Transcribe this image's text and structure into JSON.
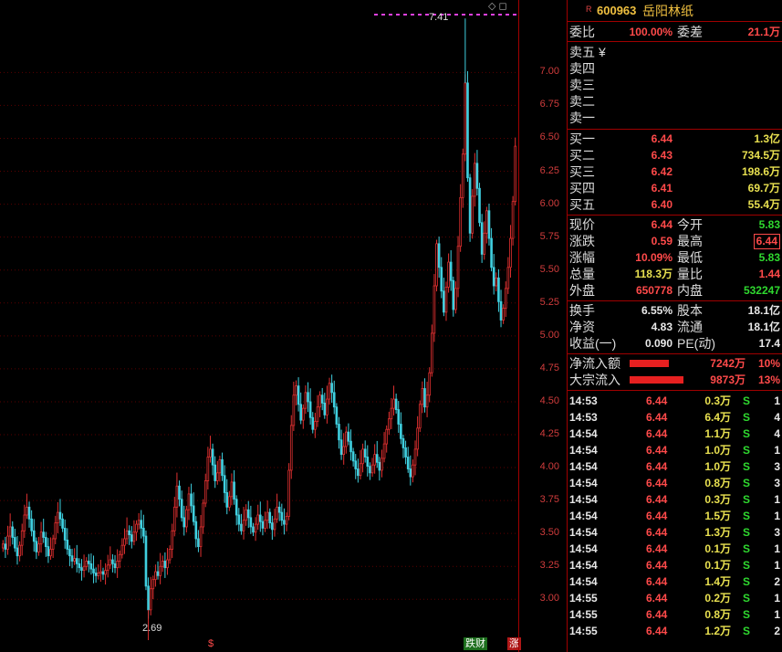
{
  "stock": {
    "r_mark": "R",
    "code": "600963",
    "name": "岳阳林纸"
  },
  "price_axis": {
    "ticks": [
      "7.00",
      "6.75",
      "6.50",
      "6.25",
      "6.00",
      "5.75",
      "5.50",
      "5.25",
      "5.00",
      "4.75",
      "4.50",
      "4.25",
      "4.00",
      "3.75",
      "3.50",
      "3.25",
      "3.00"
    ],
    "high_label": "7.41",
    "low_label": "2.69",
    "top_icons": "◇ ◻"
  },
  "chart_data": {
    "type": "candlestick",
    "y_range": [
      2.6,
      7.55
    ],
    "high": 7.41,
    "low": 2.69,
    "colors": {
      "up": "#e03030",
      "down": "#40d0e0"
    },
    "closes": [
      3.42,
      3.38,
      3.48,
      3.55,
      3.47,
      3.39,
      3.33,
      3.41,
      3.52,
      3.64,
      3.7,
      3.61,
      3.52,
      3.44,
      3.36,
      3.42,
      3.51,
      3.47,
      3.4,
      3.33,
      3.38,
      3.46,
      3.58,
      3.66,
      3.61,
      3.54,
      3.45,
      3.38,
      3.33,
      3.29,
      3.31,
      3.27,
      3.24,
      3.22,
      3.25,
      3.29,
      3.27,
      3.23,
      3.2,
      3.18,
      3.2,
      3.21,
      3.19,
      3.22,
      3.26,
      3.3,
      3.27,
      3.24,
      3.29,
      3.34,
      3.41,
      3.46,
      3.52,
      3.49,
      3.44,
      3.51,
      3.57,
      3.6,
      3.54,
      3.48,
      3.1,
      2.92,
      3.08,
      3.15,
      3.21,
      3.18,
      3.25,
      3.29,
      3.24,
      3.3,
      3.38,
      3.52,
      3.7,
      3.86,
      3.76,
      3.62,
      3.55,
      3.68,
      3.8,
      3.71,
      3.59,
      3.46,
      3.4,
      3.55,
      3.73,
      3.9,
      4.08,
      4.14,
      4.02,
      3.9,
      3.96,
      4.06,
      3.94,
      3.81,
      3.7,
      3.78,
      3.89,
      3.76,
      3.64,
      3.57,
      3.52,
      3.6,
      3.68,
      3.62,
      3.55,
      3.51,
      3.57,
      3.64,
      3.59,
      3.54,
      3.6,
      3.66,
      3.58,
      3.53,
      3.61,
      3.7,
      3.66,
      3.6,
      3.57,
      3.63,
      3.98,
      4.32,
      4.55,
      4.62,
      4.48,
      4.36,
      4.45,
      4.57,
      4.5,
      4.38,
      4.29,
      4.35,
      4.46,
      4.55,
      4.49,
      4.4,
      4.52,
      4.64,
      4.57,
      4.46,
      4.33,
      4.21,
      4.1,
      4.16,
      4.27,
      4.2,
      4.12,
      4.05,
      3.99,
      3.94,
      4.03,
      4.14,
      4.08,
      4.01,
      3.96,
      4.02,
      4.1,
      4.04,
      3.98,
      4.07,
      4.18,
      4.29,
      4.37,
      4.45,
      4.52,
      4.44,
      4.33,
      4.22,
      4.15,
      4.08,
      3.99,
      3.93,
      4.02,
      4.14,
      4.3,
      4.48,
      4.6,
      4.46,
      4.55,
      4.72,
      5.02,
      5.38,
      5.7,
      5.52,
      5.34,
      5.18,
      5.37,
      5.56,
      5.42,
      5.2,
      5.36,
      5.68,
      6.05,
      6.38,
      6.92,
      6.2,
      5.78,
      6.06,
      6.31,
      6.12,
      5.86,
      5.62,
      5.78,
      5.95,
      5.74,
      5.52,
      5.38,
      5.44,
      5.26,
      5.12,
      5.21,
      5.36,
      5.52,
      5.74,
      6.02,
      6.44
    ],
    "volume_axis_markers": [
      "$",
      "跌财",
      "涨"
    ]
  },
  "order_book": {
    "weibi_label": "委比",
    "weibi_value": "100.00%",
    "weicha_label": "委差",
    "weicha_value": "21.1万",
    "sell": [
      {
        "label": "卖五",
        "suffix": "¥"
      },
      {
        "label": "卖四"
      },
      {
        "label": "卖三"
      },
      {
        "label": "卖二"
      },
      {
        "label": "卖一"
      }
    ],
    "buy": [
      {
        "label": "买一",
        "price": "6.44",
        "vol": "1.3亿"
      },
      {
        "label": "买二",
        "price": "6.43",
        "vol": "734.5万"
      },
      {
        "label": "买三",
        "price": "6.42",
        "vol": "198.6万"
      },
      {
        "label": "买四",
        "price": "6.41",
        "vol": "69.7万"
      },
      {
        "label": "买五",
        "price": "6.40",
        "vol": "55.4万"
      }
    ]
  },
  "quote": {
    "xianjia_label": "现价",
    "xianjia": "6.44",
    "jinkai_label": "今开",
    "jinkai": "5.83",
    "zhangdie_label": "涨跌",
    "zhangdie": "0.59",
    "zuigao_label": "最高",
    "zuigao": "6.44",
    "zhangfu_label": "涨幅",
    "zhangfu": "10.09%",
    "zuidi_label": "最低",
    "zuidi": "5.83",
    "zongliang_label": "总量",
    "zongliang": "118.3万",
    "liangbi_label": "量比",
    "liangbi": "1.44",
    "waipan_label": "外盘",
    "waipan": "650778",
    "neipan_label": "内盘",
    "neipan": "532247",
    "huanshou_label": "换手",
    "huanshou": "6.55%",
    "guben_label": "股本",
    "guben": "18.1亿",
    "jingzi_label": "净资",
    "jingzi": "4.83",
    "liutong_label": "流通",
    "liutong": "18.1亿",
    "shouyi_label": "收益(一)",
    "shouyi": "0.090",
    "pe_label": "PE(动)",
    "pe": "17.4"
  },
  "flows": {
    "net_label": "净流入额",
    "net_value": "7242万",
    "net_pct": "10%",
    "net_fill": 0.72,
    "block_label": "大宗流入",
    "block_value": "9873万",
    "block_pct": "13%",
    "block_fill": 0.98
  },
  "ticks": [
    {
      "time": "14:53",
      "price": "6.44",
      "vol": "0.3万",
      "bs": "S",
      "n": "1"
    },
    {
      "time": "14:53",
      "price": "6.44",
      "vol": "6.4万",
      "bs": "S",
      "n": "4"
    },
    {
      "time": "14:54",
      "price": "6.44",
      "vol": "1.1万",
      "bs": "S",
      "n": "4"
    },
    {
      "time": "14:54",
      "price": "6.44",
      "vol": "1.0万",
      "bs": "S",
      "n": "1"
    },
    {
      "time": "14:54",
      "price": "6.44",
      "vol": "1.0万",
      "bs": "S",
      "n": "3"
    },
    {
      "time": "14:54",
      "price": "6.44",
      "vol": "0.8万",
      "bs": "S",
      "n": "3"
    },
    {
      "time": "14:54",
      "price": "6.44",
      "vol": "0.3万",
      "bs": "S",
      "n": "1"
    },
    {
      "time": "14:54",
      "price": "6.44",
      "vol": "1.5万",
      "bs": "S",
      "n": "1"
    },
    {
      "time": "14:54",
      "price": "6.44",
      "vol": "1.3万",
      "bs": "S",
      "n": "3"
    },
    {
      "time": "14:54",
      "price": "6.44",
      "vol": "0.1万",
      "bs": "S",
      "n": "1"
    },
    {
      "time": "14:54",
      "price": "6.44",
      "vol": "0.1万",
      "bs": "S",
      "n": "1"
    },
    {
      "time": "14:54",
      "price": "6.44",
      "vol": "1.4万",
      "bs": "S",
      "n": "2"
    },
    {
      "time": "14:55",
      "price": "6.44",
      "vol": "0.2万",
      "bs": "S",
      "n": "1"
    },
    {
      "time": "14:55",
      "price": "6.44",
      "vol": "0.8万",
      "bs": "S",
      "n": "1"
    },
    {
      "time": "14:55",
      "price": "6.44",
      "vol": "1.2万",
      "bs": "S",
      "n": "2"
    }
  ]
}
